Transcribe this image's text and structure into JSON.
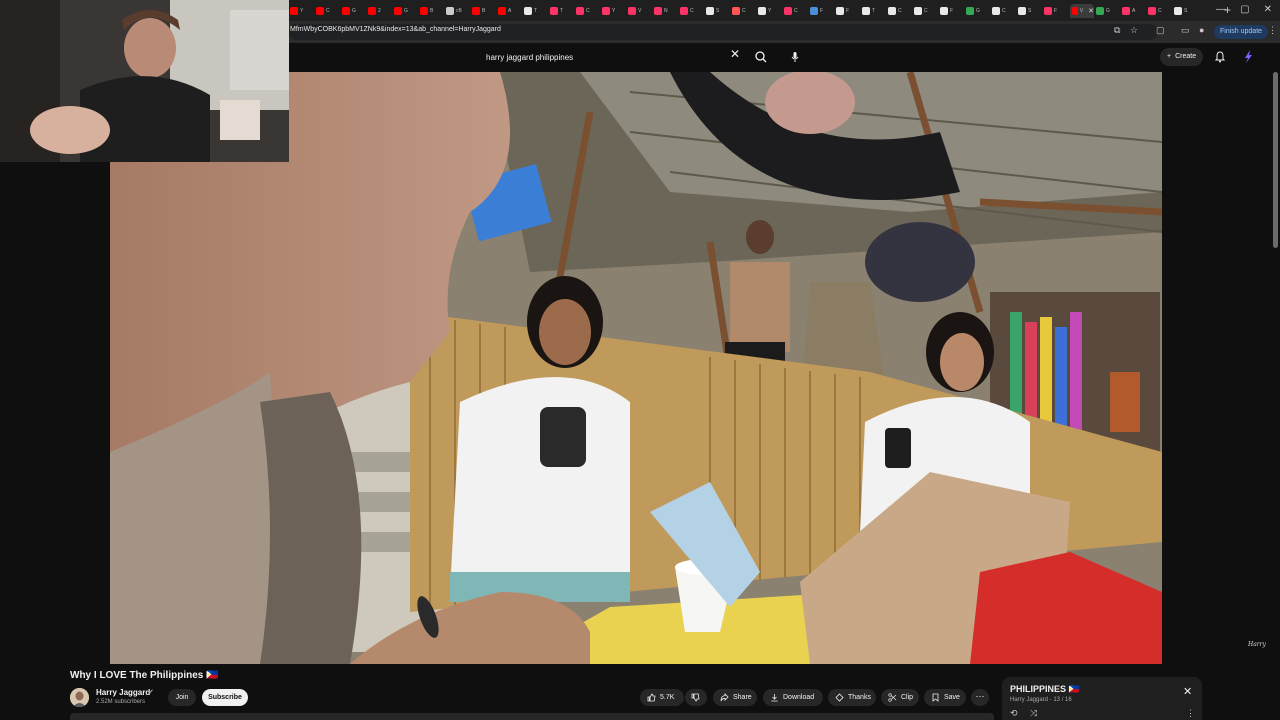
{
  "browser": {
    "tabs": [
      {
        "title": "Y",
        "color": "#ff0000"
      },
      {
        "title": "C",
        "color": "#ff0000"
      },
      {
        "title": "G",
        "color": "#ff0000"
      },
      {
        "title": "2",
        "color": "#ff0000"
      },
      {
        "title": "G",
        "color": "#ff0000"
      },
      {
        "title": "B",
        "color": "#ff0000"
      },
      {
        "title": "cB",
        "color": "#cccccc"
      },
      {
        "title": "B",
        "color": "#ff0000"
      },
      {
        "title": "A",
        "color": "#ff0000"
      },
      {
        "title": "T",
        "color": "#e8e8e8"
      },
      {
        "title": "T",
        "color": "#ff3366"
      },
      {
        "title": "C",
        "color": "#ff3366"
      },
      {
        "title": "Y",
        "color": "#ff3366"
      },
      {
        "title": "V",
        "color": "#ff3366"
      },
      {
        "title": "N",
        "color": "#ff3366"
      },
      {
        "title": "C",
        "color": "#ff3366"
      },
      {
        "title": "S",
        "color": "#e8e8e8"
      },
      {
        "title": "C",
        "color": "#ff5555"
      },
      {
        "title": "Y",
        "color": "#e8e8e8"
      },
      {
        "title": "C",
        "color": "#ff3366"
      },
      {
        "title": "F",
        "color": "#4a90d9"
      },
      {
        "title": "F",
        "color": "#e8e8e8"
      },
      {
        "title": "T",
        "color": "#e8e8e8"
      },
      {
        "title": "C",
        "color": "#e8e8e8"
      },
      {
        "title": "C",
        "color": "#e8e8e8"
      },
      {
        "title": "F",
        "color": "#e8e8e8"
      },
      {
        "title": "G",
        "color": "#34a853"
      },
      {
        "title": "C",
        "color": "#e8e8e8"
      },
      {
        "title": "S",
        "color": "#e8e8e8"
      },
      {
        "title": "F",
        "color": "#ff3366"
      },
      {
        "title": "V",
        "color": "#ff0000"
      },
      {
        "title": "G",
        "color": "#34a853"
      },
      {
        "title": "A",
        "color": "#ff3366"
      },
      {
        "title": "C",
        "color": "#ff3366"
      },
      {
        "title": "S",
        "color": "#e8e8e8"
      }
    ],
    "url": "MfmWbyCOBK6pbMV1ZNk9&index=13&ab_channel=HarryJaggard",
    "finish_update_label": "Finish update"
  },
  "youtube": {
    "search_value": "harry jaggard philippines",
    "create_label": "Create",
    "video_title": "Why I LOVE The Philippines 🇵🇭",
    "channel_name": "Harry Jaggard",
    "subscribers": "2.52M subscribers",
    "join_label": "Join",
    "subscribe_label": "Subscribe",
    "like_count": "5.7K",
    "share_label": "Share",
    "download_label": "Download",
    "thanks_label": "Thanks",
    "clip_label": "Clip",
    "save_label": "Save",
    "more_label": "⋯",
    "playlist_title": "PHILIPPINES 🇵🇭",
    "playlist_sub": "Harry Jaggard - 13 / 16"
  },
  "colors": {
    "accent": "#f1f1f1",
    "background": "#0f0f0f",
    "chip": "#272727"
  }
}
